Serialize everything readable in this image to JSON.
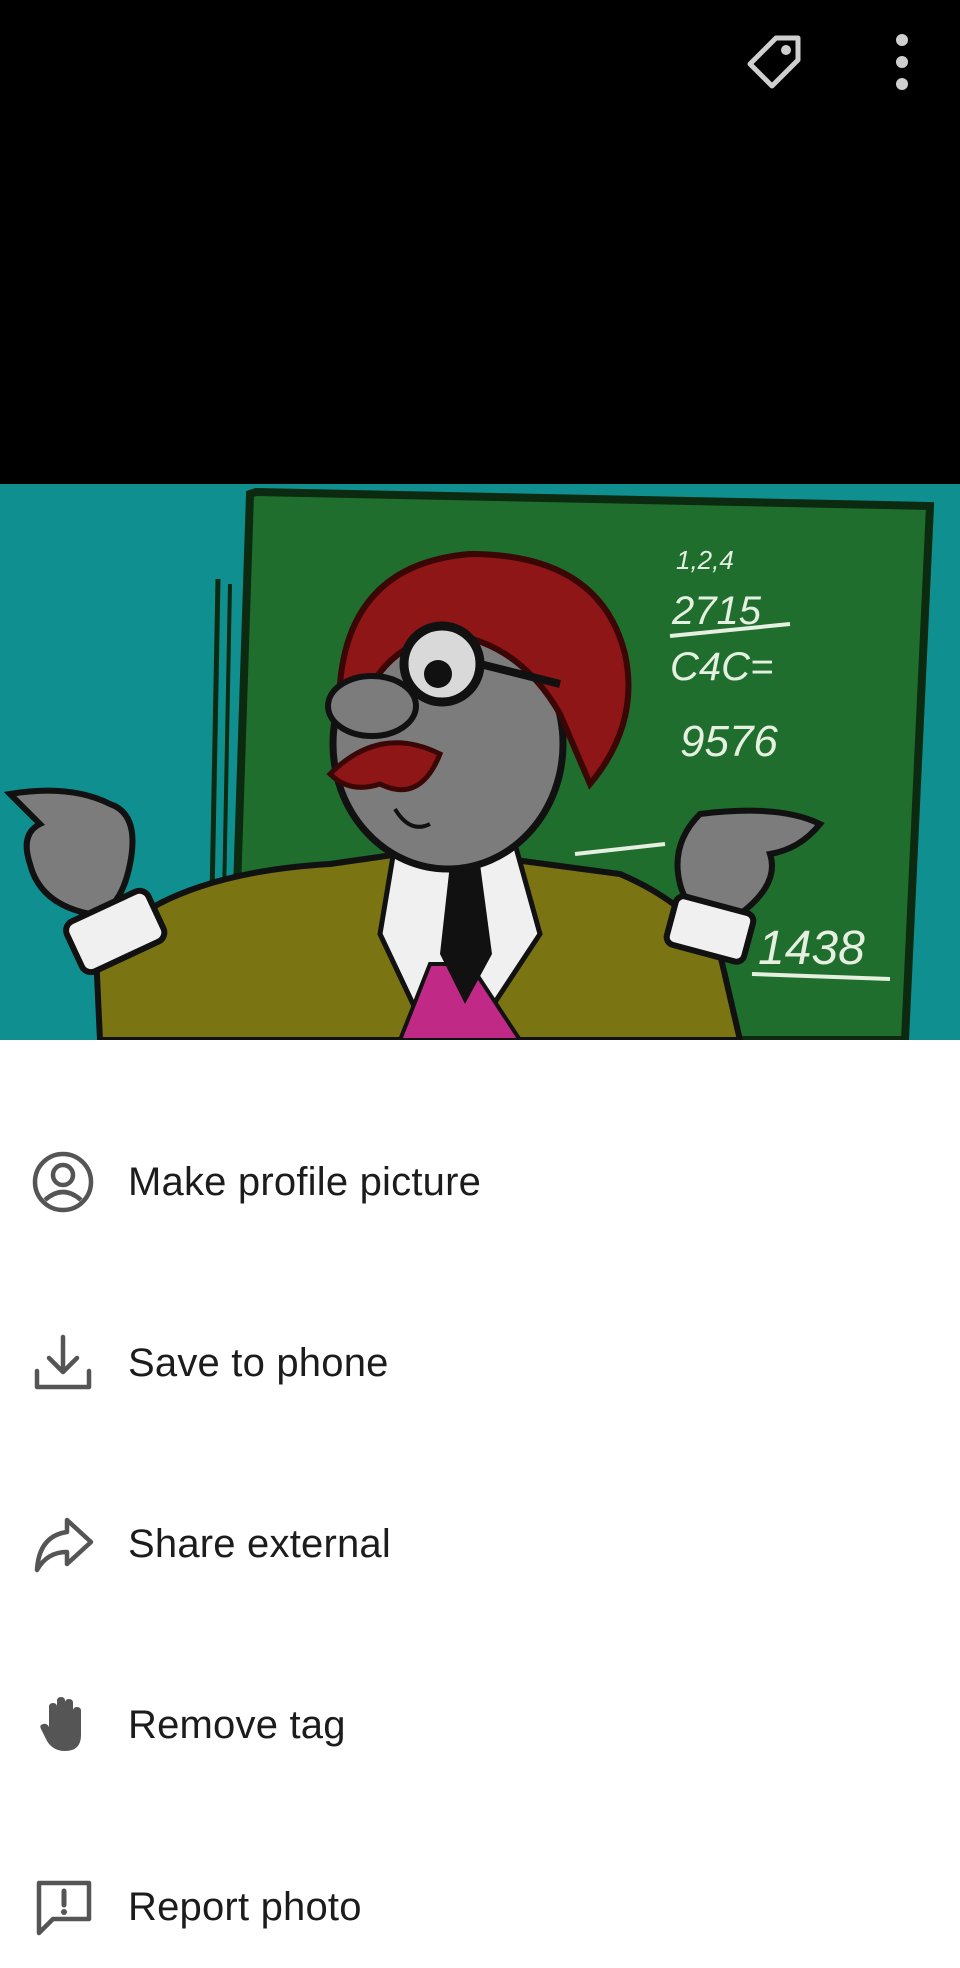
{
  "colors": {
    "top_background": "#000000",
    "top_icon": "#cfcfcf",
    "sheet_background": "#ffffff",
    "menu_text": "#1c1c1c",
    "menu_icon": "#555555",
    "photo_teal": "#0f8f90",
    "board_green": "#1f6e2e"
  },
  "top_bar": {
    "icons": [
      "tag-icon",
      "more-vert-icon"
    ]
  },
  "photo": {
    "board_numbers": [
      "1,2,4",
      "2715",
      "C4C=",
      "9576",
      "1438"
    ]
  },
  "menu": {
    "items": [
      {
        "label": "Make profile picture",
        "icon": "account-circle-icon"
      },
      {
        "label": "Save to phone",
        "icon": "download-icon"
      },
      {
        "label": "Share external",
        "icon": "share-arrow-icon"
      },
      {
        "label": "Remove tag",
        "icon": "hand-icon"
      },
      {
        "label": "Report photo",
        "icon": "report-flag-icon"
      }
    ]
  }
}
